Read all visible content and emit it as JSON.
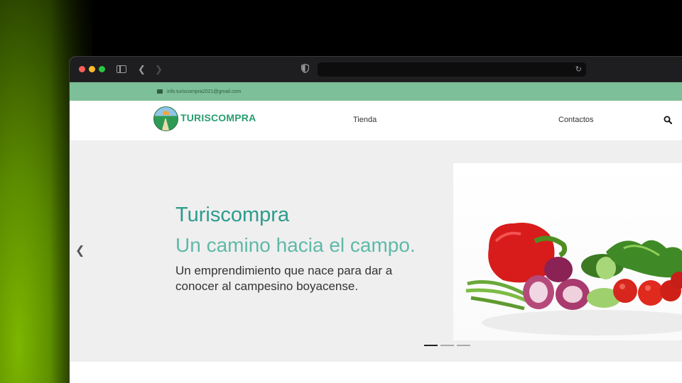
{
  "browser": {
    "url": ""
  },
  "topbar": {
    "email": "info.turiscompra2021@gmail.com"
  },
  "nav": {
    "logo_text": "TURISCOMPRA",
    "links": [
      "Tienda",
      "Contactos"
    ]
  },
  "hero": {
    "title": "Turiscompra",
    "subtitle": "Un camino hacia el campo.",
    "description": "Un emprendimiento que nace para dar a conocer al campesino boyacense.",
    "prev_icon": "chevron-left-icon",
    "slides": 3,
    "active_slide": 1
  },
  "colors": {
    "accent": "#2e9b8c",
    "topbar": "#7dbf98",
    "logo": "#2a9d6f"
  }
}
